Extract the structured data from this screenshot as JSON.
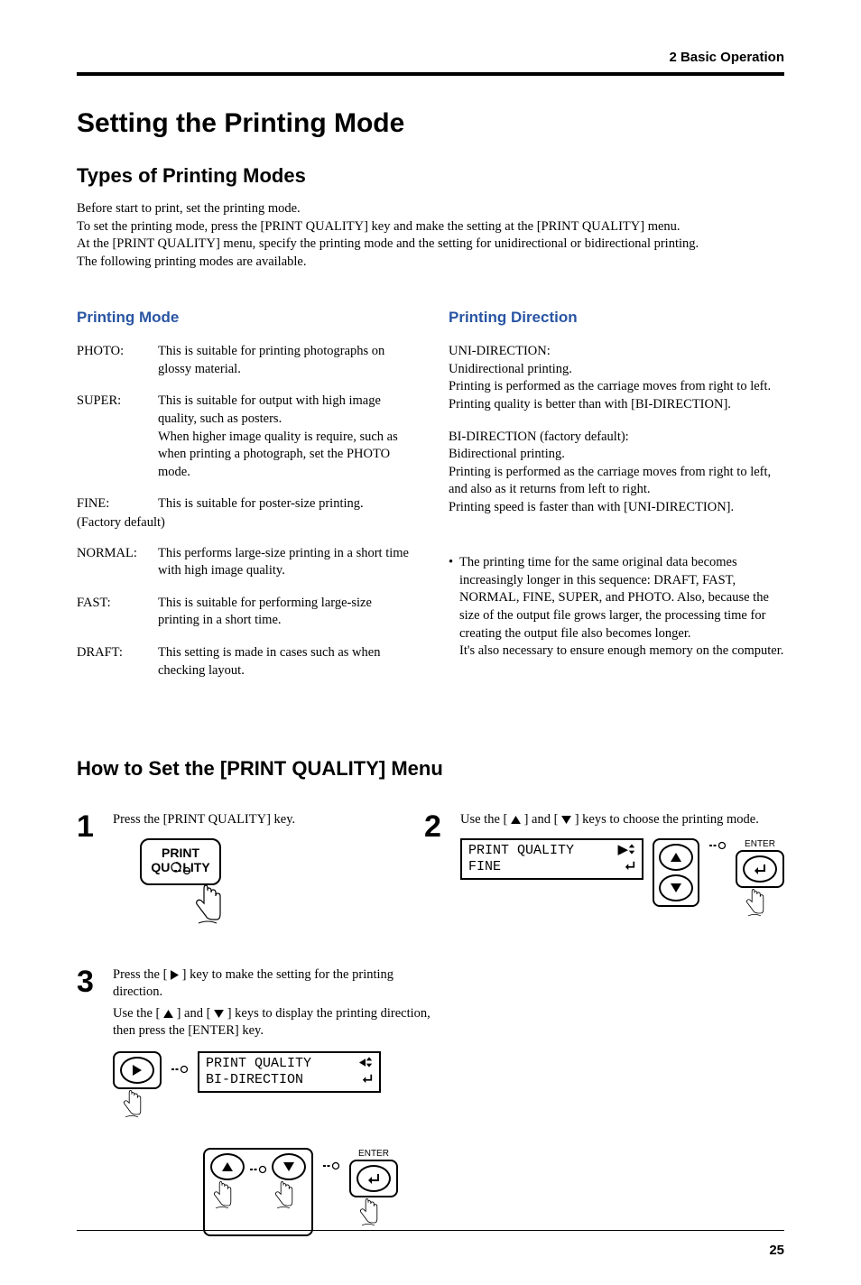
{
  "chapter": "2   Basic Operation",
  "title": "Setting the Printing Mode",
  "section_types": "Types of Printing Modes",
  "intro": [
    "Before start to print, set the printing mode.",
    "To set the printing mode, press the [PRINT QUALITY] key and make the setting at the [PRINT QUALITY] menu.",
    "At the [PRINT QUALITY] menu, specify the printing mode and the setting for unidirectional or bidirectional printing.",
    "The following printing modes are available."
  ],
  "printing_mode_heading": "Printing Mode",
  "printing_direction_heading": "Printing Direction",
  "modes": {
    "photo": {
      "label": "PHOTO:",
      "desc": "This is suitable for printing photographs on glossy material."
    },
    "super": {
      "label": "SUPER:",
      "desc": "This is suitable for output with high image quality, such as posters.\nWhen higher image quality is require, such as when printing a photograph, set the PHOTO mode."
    },
    "fine": {
      "label": "FINE:",
      "desc": "This is suitable for poster-size printing."
    },
    "fine_default": "(Factory default)",
    "normal": {
      "label": "NORMAL:",
      "desc": "This performs large-size printing in a short time with high image quality."
    },
    "fast": {
      "label": "FAST:",
      "desc": "This is suitable for performing large-size printing in a short time."
    },
    "draft": {
      "label": "DRAFT:",
      "desc": "This setting is made in cases such as when checking layout."
    }
  },
  "directions": {
    "uni": {
      "title": "UNI-DIRECTION:",
      "l1": "Unidirectional printing.",
      "l2": "Printing is performed as the carriage moves from right to left.",
      "l3": "Printing quality is better than with [BI-DIRECTION]."
    },
    "bi": {
      "title": "BI-DIRECTION (factory default):",
      "l1": "Bidirectional printing.",
      "l2": "Printing is performed as the carriage moves from right to left, and also as it returns from left to right.",
      "l3": "Printing speed is faster than with [UNI-DIRECTION]."
    },
    "note": "The printing time for the same original data becomes increasingly longer in this sequence: DRAFT, FAST, NORMAL, FINE, SUPER, and PHOTO.  Also, because the size of the output file grows larger, the processing time for creating the output file also becomes longer.\nIt's also necessary to ensure enough memory on the computer."
  },
  "howto_heading": "How to Set the [PRINT QUALITY] Menu",
  "steps": {
    "s1": {
      "num": "1",
      "text": "Press the [PRINT QUALITY] key.",
      "button_l1": "PRINT",
      "button_l2": "QU",
      "button_l2b": "LITY"
    },
    "s2": {
      "num": "2",
      "text_a": "Use the [ ",
      "text_b": " ] and [ ",
      "text_c": " ] keys to choose the printing mode.",
      "lcd_l1": "PRINT QUALITY",
      "lcd_l2": "FINE",
      "enter_label": "ENTER"
    },
    "s3": {
      "num": "3",
      "text1_a": "Press the [ ",
      "text1_b": " ] key to make the setting for the printing direction.",
      "text2_a": "Use the [ ",
      "text2_b": " ] and [ ",
      "text2_c": " ] keys to display the printing direction, then press the [ENTER] key.",
      "lcd_l1": "PRINT QUALITY",
      "lcd_l2": "BI-DIRECTION",
      "enter_label": "ENTER"
    }
  },
  "page_number": "25"
}
